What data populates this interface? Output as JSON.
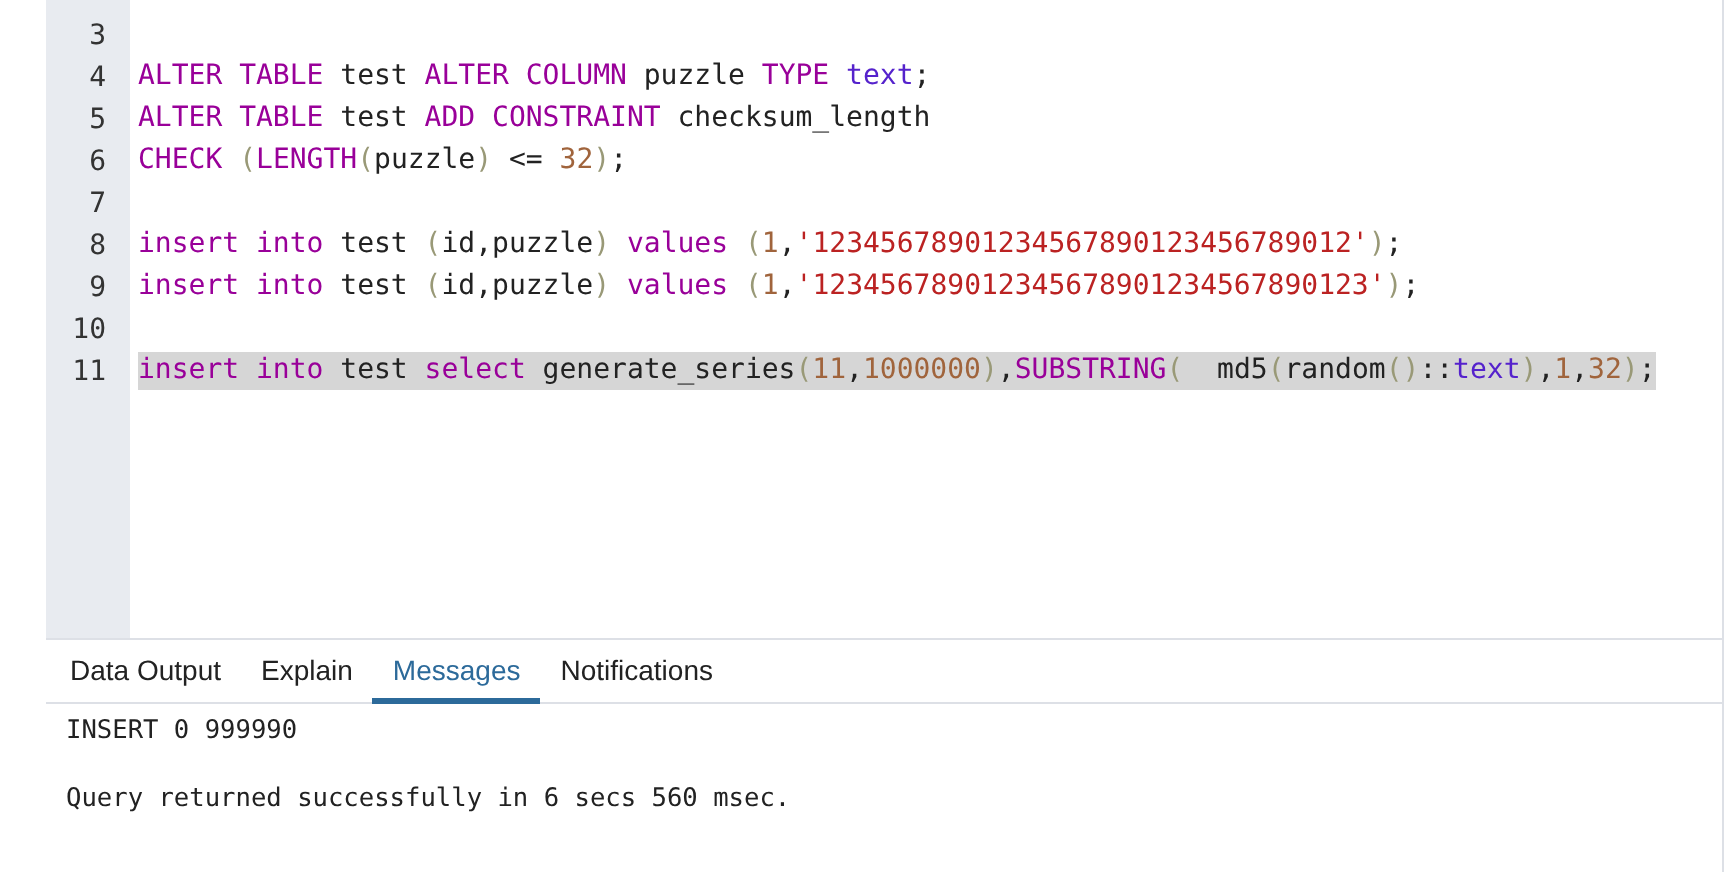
{
  "editor": {
    "lines": [
      {
        "number": "3"
      },
      {
        "number": "4",
        "highlighted": false,
        "tokens": [
          {
            "kind": "keyword",
            "text": "ALTER TABLE"
          },
          {
            "kind": "plain",
            "text": " test "
          },
          {
            "kind": "keyword",
            "text": "ALTER COLUMN"
          },
          {
            "kind": "plain",
            "text": " puzzle "
          },
          {
            "kind": "keyword",
            "text": "TYPE "
          },
          {
            "kind": "type",
            "text": "text"
          },
          {
            "kind": "plain",
            "text": ";"
          }
        ]
      },
      {
        "number": "5",
        "highlighted": false,
        "tokens": [
          {
            "kind": "keyword",
            "text": "ALTER TABLE"
          },
          {
            "kind": "plain",
            "text": " test "
          },
          {
            "kind": "keyword",
            "text": "ADD CONSTRAINT"
          },
          {
            "kind": "plain",
            "text": " checksum_length"
          }
        ]
      },
      {
        "number": "6",
        "highlighted": false,
        "tokens": [
          {
            "kind": "keyword",
            "text": "CHECK "
          },
          {
            "kind": "paren",
            "text": "("
          },
          {
            "kind": "keyword",
            "text": "LENGTH"
          },
          {
            "kind": "paren",
            "text": "("
          },
          {
            "kind": "plain",
            "text": "puzzle"
          },
          {
            "kind": "paren",
            "text": ")"
          },
          {
            "kind": "plain",
            "text": " <= "
          },
          {
            "kind": "number",
            "text": "32"
          },
          {
            "kind": "paren",
            "text": ")"
          },
          {
            "kind": "plain",
            "text": ";"
          }
        ]
      },
      {
        "number": "7"
      },
      {
        "number": "8",
        "highlighted": false,
        "tokens": [
          {
            "kind": "keyword",
            "text": "insert into"
          },
          {
            "kind": "plain",
            "text": " test "
          },
          {
            "kind": "paren",
            "text": "("
          },
          {
            "kind": "plain",
            "text": "id,puzzle"
          },
          {
            "kind": "paren",
            "text": ")"
          },
          {
            "kind": "keyword",
            "text": " values "
          },
          {
            "kind": "paren",
            "text": "("
          },
          {
            "kind": "number",
            "text": "1"
          },
          {
            "kind": "plain",
            "text": ","
          },
          {
            "kind": "string",
            "text": "'12345678901234567890123456789012'"
          },
          {
            "kind": "paren",
            "text": ")"
          },
          {
            "kind": "plain",
            "text": ";"
          }
        ]
      },
      {
        "number": "9",
        "highlighted": false,
        "tokens": [
          {
            "kind": "keyword",
            "text": "insert into"
          },
          {
            "kind": "plain",
            "text": " test "
          },
          {
            "kind": "paren",
            "text": "("
          },
          {
            "kind": "plain",
            "text": "id,puzzle"
          },
          {
            "kind": "paren",
            "text": ")"
          },
          {
            "kind": "keyword",
            "text": " values "
          },
          {
            "kind": "paren",
            "text": "("
          },
          {
            "kind": "number",
            "text": "1"
          },
          {
            "kind": "plain",
            "text": ","
          },
          {
            "kind": "string",
            "text": "'123456789012345678901234567890123'"
          },
          {
            "kind": "paren",
            "text": ")"
          },
          {
            "kind": "plain",
            "text": ";"
          }
        ]
      },
      {
        "number": "10"
      },
      {
        "number": "11",
        "highlighted": true,
        "tokens": [
          {
            "kind": "keyword",
            "text": "insert into"
          },
          {
            "kind": "plain",
            "text": " test "
          },
          {
            "kind": "keyword",
            "text": "select"
          },
          {
            "kind": "plain",
            "text": " generate_series"
          },
          {
            "kind": "paren",
            "text": "("
          },
          {
            "kind": "number",
            "text": "11"
          },
          {
            "kind": "plain",
            "text": ","
          },
          {
            "kind": "number",
            "text": "1000000"
          },
          {
            "kind": "paren",
            "text": ")"
          },
          {
            "kind": "plain",
            "text": ","
          },
          {
            "kind": "keyword",
            "text": "SUBSTRING"
          },
          {
            "kind": "paren",
            "text": "("
          },
          {
            "kind": "plain",
            "text": "  md5"
          },
          {
            "kind": "paren",
            "text": "("
          },
          {
            "kind": "plain",
            "text": "random"
          },
          {
            "kind": "paren",
            "text": "()"
          },
          {
            "kind": "plain",
            "text": "::"
          },
          {
            "kind": "type",
            "text": "text"
          },
          {
            "kind": "paren",
            "text": ")"
          },
          {
            "kind": "plain",
            "text": ","
          },
          {
            "kind": "number",
            "text": "1"
          },
          {
            "kind": "plain",
            "text": ","
          },
          {
            "kind": "number",
            "text": "32"
          },
          {
            "kind": "paren",
            "text": ")"
          },
          {
            "kind": "plain",
            "text": ";"
          }
        ]
      }
    ]
  },
  "tabs": [
    {
      "label": "Data Output",
      "selected": false
    },
    {
      "label": "Explain",
      "selected": false
    },
    {
      "label": "Messages",
      "selected": true
    },
    {
      "label": "Notifications",
      "selected": false
    }
  ],
  "messages": [
    "INSERT 0 999990",
    "Query returned successfully in 6 secs 560 msec."
  ]
}
